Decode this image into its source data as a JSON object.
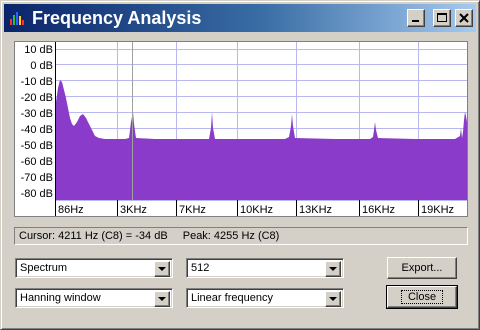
{
  "window": {
    "title": "Frequency Analysis",
    "controls": {
      "minimize": "minimize",
      "maximize": "maximize",
      "close": "close"
    }
  },
  "graph": {
    "y_labels": [
      "10 dB",
      "0 dB",
      "-10 dB",
      "-20 dB",
      "-30 dB",
      "-40 dB",
      "-50 dB",
      "-60 dB",
      "-70 dB",
      "-80 dB"
    ],
    "x_labels": [
      "86Hz",
      "3KHz",
      "7KHz",
      "10KHz",
      "13KHz",
      "16KHz",
      "19KHz"
    ],
    "fill_color": "#8a3bc9",
    "grid_color": "#b8b8ee",
    "cursor_color": "#a0a0a0"
  },
  "status": {
    "cursor": "Cursor: 4211 Hz (C8) = -34 dB",
    "peak": "Peak: 4255 Hz (C8)"
  },
  "controls": {
    "algorithm": "Spectrum",
    "size": "512",
    "window_fn": "Hanning window",
    "axis": "Linear frequency"
  },
  "buttons": {
    "export": "Export...",
    "close": "Close"
  }
}
